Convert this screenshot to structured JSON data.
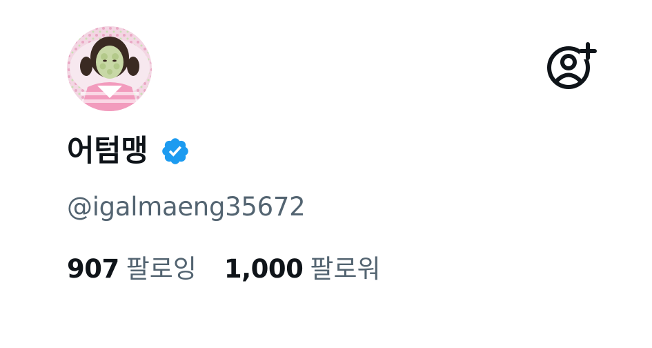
{
  "profile": {
    "display_name": "어텀맹",
    "handle": "@igalmaeng35672",
    "verified": true,
    "avatar": "avatar-photo",
    "follow_icon": "person-add-icon",
    "verified_icon": "verified-badge-icon"
  },
  "stats": {
    "following_count": "907",
    "following_label": "팔로잉",
    "followers_count": "1,000",
    "followers_label": "팔로워"
  },
  "colors": {
    "text_primary": "#0f1419",
    "text_secondary": "#536471",
    "verified_blue": "#1d9bf0",
    "background": "#ffffff"
  }
}
